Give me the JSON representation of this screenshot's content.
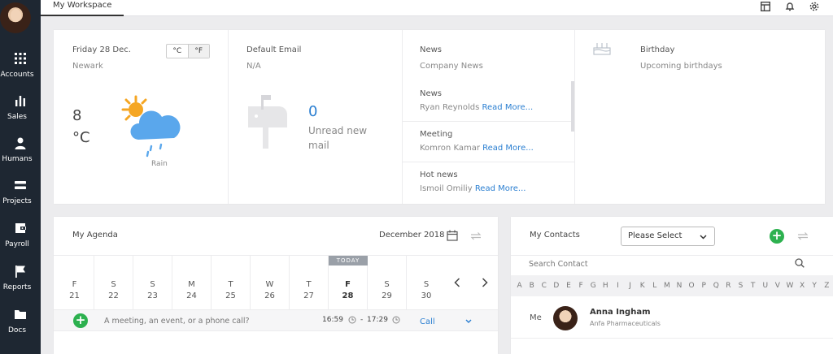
{
  "sidebar": {
    "items": [
      {
        "label": "Accounts",
        "icon": "grid-icon"
      },
      {
        "label": "Sales",
        "icon": "bar-chart-icon"
      },
      {
        "label": "Humans",
        "icon": "person-icon"
      },
      {
        "label": "Projects",
        "icon": "projects-icon"
      },
      {
        "label": "Payroll",
        "icon": "wallet-icon"
      },
      {
        "label": "Reports",
        "icon": "flag-icon"
      },
      {
        "label": "Docs",
        "icon": "folder-icon"
      }
    ]
  },
  "topbar": {
    "tab": "My Workspace",
    "icons": [
      "layout-icon",
      "bell-icon",
      "gear-icon"
    ]
  },
  "weather": {
    "date": "Friday 28 Dec.",
    "city": "Newark",
    "unit_c": "°C",
    "unit_f": "°F",
    "temp": "8",
    "temp_unit": "°C",
    "condition": "Rain"
  },
  "email": {
    "title": "Default Email",
    "value": "N/A",
    "count": "0",
    "caption_line1": "Unread new",
    "caption_line2": "mail"
  },
  "news": {
    "title": "News",
    "subtitle": "Company News",
    "read_more": "Read More...",
    "items": [
      {
        "heading": "News",
        "author": "Ryan Reynolds"
      },
      {
        "heading": "Meeting",
        "author": "Komron Kamar"
      },
      {
        "heading": "Hot news",
        "author": "Ismoil Omiliy"
      }
    ]
  },
  "birthday": {
    "title": "Birthday",
    "subtitle": "Upcoming birthdays"
  },
  "agenda": {
    "title": "My Agenda",
    "month": "December 2018",
    "today_label": "TODAY",
    "days": [
      {
        "d": "F",
        "n": "21"
      },
      {
        "d": "S",
        "n": "22"
      },
      {
        "d": "S",
        "n": "23"
      },
      {
        "d": "M",
        "n": "24"
      },
      {
        "d": "T",
        "n": "25"
      },
      {
        "d": "W",
        "n": "26"
      },
      {
        "d": "T",
        "n": "27"
      },
      {
        "d": "F",
        "n": "28"
      },
      {
        "d": "S",
        "n": "29"
      },
      {
        "d": "S",
        "n": "30"
      }
    ],
    "event_placeholder": "A meeting, an event, or a phone call?",
    "time_start": "16:59",
    "time_sep": "-",
    "time_end": "17:29",
    "event_type": "Call"
  },
  "contacts": {
    "title": "My Contacts",
    "select_value": "Please Select",
    "search_placeholder": "Search Contact",
    "letters": [
      "A",
      "B",
      "C",
      "D",
      "E",
      "F",
      "G",
      "H",
      "I",
      "J",
      "K",
      "L",
      "M",
      "N",
      "O",
      "P",
      "Q",
      "R",
      "S",
      "T",
      "U",
      "V",
      "W",
      "X",
      "Y",
      "Z"
    ],
    "me_label": "Me",
    "me_name": "Anna Ingham",
    "me_company": "Anfa Pharmaceuticals"
  },
  "colors": {
    "sidebar": "#1e2732",
    "accent_blue": "#2b7fd1",
    "green": "#2db14f",
    "cloud": "#5aa7ec",
    "sun": "#f5a623"
  }
}
